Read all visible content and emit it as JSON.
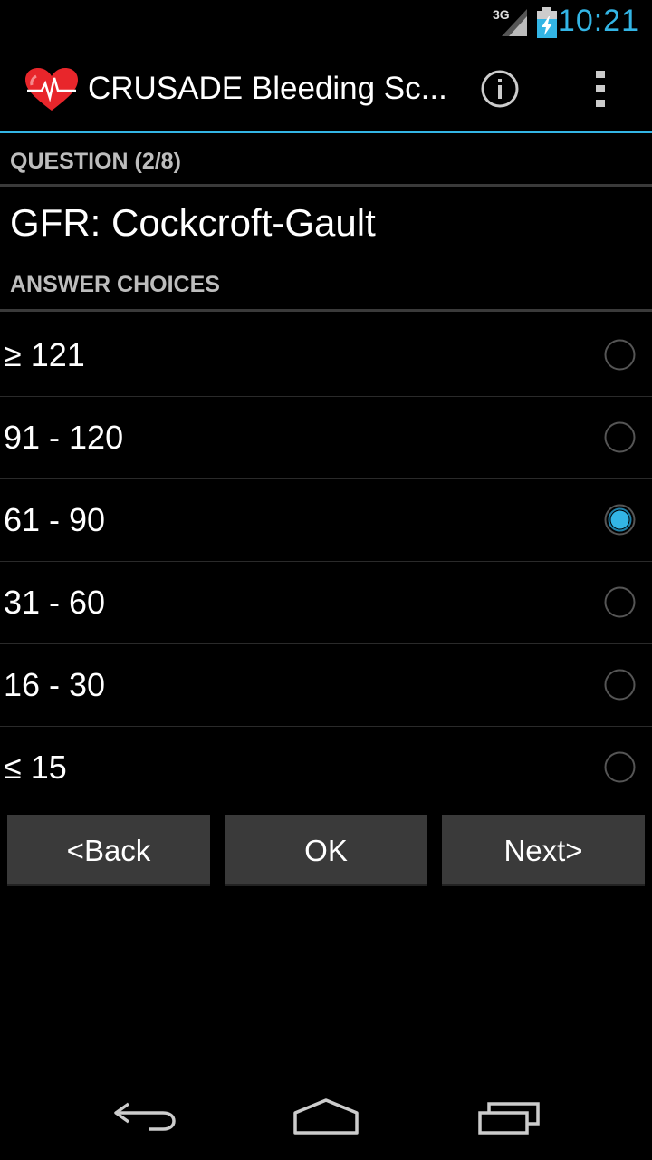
{
  "status_bar": {
    "network": "3G",
    "time": "10:21",
    "accent_color": "#33b5e5"
  },
  "action_bar": {
    "title": "CRUSADE Bleeding Sc...",
    "icons": [
      "heart-icon",
      "info-icon",
      "overflow-menu-icon"
    ]
  },
  "question": {
    "header": "QUESTION (2/8)",
    "text": "GFR: Cockcroft-Gault"
  },
  "answers": {
    "header": "ANSWER CHOICES",
    "items": [
      {
        "label": "≥ 121",
        "selected": false
      },
      {
        "label": "91 - 120",
        "selected": false
      },
      {
        "label": "61 - 90",
        "selected": true
      },
      {
        "label": "31 - 60",
        "selected": false
      },
      {
        "label": "16 - 30",
        "selected": false
      },
      {
        "label": "≤ 15",
        "selected": false
      }
    ]
  },
  "buttons": {
    "back": "<Back",
    "ok": "OK",
    "next": "Next>"
  },
  "nav_bar": {
    "icons": [
      "back-icon",
      "home-icon",
      "recent-apps-icon"
    ]
  }
}
